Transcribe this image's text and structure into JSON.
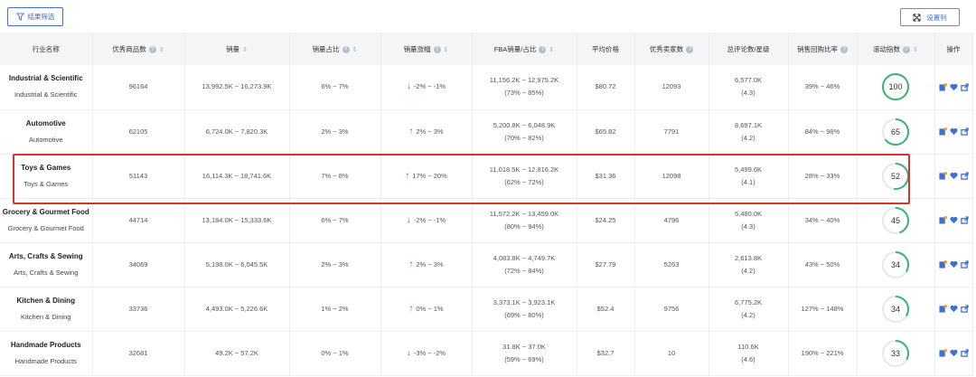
{
  "toolbar": {
    "filter_label": "结果筛选",
    "settings_label": "设置列"
  },
  "columns": [
    {
      "label": "行业名称",
      "help": false,
      "sort": false
    },
    {
      "label": "优秀商品数",
      "help": true,
      "sort": true
    },
    {
      "label": "销量",
      "help": false,
      "sort": true
    },
    {
      "label": "销量占比",
      "help": true,
      "sort": true
    },
    {
      "label": "销量涨幅",
      "help": true,
      "sort": true
    },
    {
      "label": "FBA销量/占比",
      "help": true,
      "sort": true
    },
    {
      "label": "平均价格",
      "help": false,
      "sort": false
    },
    {
      "label": "优秀卖家数",
      "help": true,
      "sort": false
    },
    {
      "label": "总评论数/星级",
      "help": false,
      "sort": false
    },
    {
      "label": "销售回购比率",
      "help": true,
      "sort": false
    },
    {
      "label": "滚动指数",
      "help": true,
      "sort": true
    },
    {
      "label": "操作",
      "help": false,
      "sort": false
    }
  ],
  "colors": {
    "accent": "#3d6fd6",
    "ring_green": "#3cb371",
    "ring_track": "#e6e8eb",
    "highlight": "#d63333"
  },
  "rows": [
    {
      "name": "Industrial & Scientific",
      "sub": "Industrial & Scientific",
      "products": "96164",
      "sales": "13,992.5K ~ 16,273.9K",
      "share": "6% ~ 7%",
      "growth_dir": "down",
      "growth": "-2% ~ -1%",
      "fba": "11,156.2K ~ 12,975.2K",
      "fba_pct": "(73% ~ 85%)",
      "price": "$80.72",
      "sellers": "12093",
      "reviews": "6,577.0K",
      "stars": "(4.3)",
      "repurchase": "39% ~ 46%",
      "score": 100
    },
    {
      "name": "Automotive",
      "sub": "Automotive",
      "products": "62105",
      "sales": "6,724.0K ~ 7,820.3K",
      "share": "2% ~ 3%",
      "growth_dir": "up",
      "growth": "2% ~ 3%",
      "fba": "5,200.8K ~ 6,048.9K",
      "fba_pct": "(70% ~ 82%)",
      "price": "$65.82",
      "sellers": "7791",
      "reviews": "8,697.1K",
      "stars": "(4.2)",
      "repurchase": "84% ~ 98%",
      "score": 65
    },
    {
      "name": "Toys & Games",
      "sub": "Toys & Games",
      "products": "51143",
      "sales": "16,114.3K ~ 18,741.6K",
      "share": "7% ~ 8%",
      "growth_dir": "up",
      "growth": "17% ~ 20%",
      "fba": "11,018.5K ~ 12,816.2K",
      "fba_pct": "(62% ~ 72%)",
      "price": "$31.36",
      "sellers": "12098",
      "reviews": "5,499.6K",
      "stars": "(4.1)",
      "repurchase": "28% ~ 33%",
      "score": 52
    },
    {
      "name": "Grocery & Gourmet Food",
      "sub": "Grocery & Gourmet Food",
      "products": "44714",
      "sales": "13,184.0K ~ 15,333.6K",
      "share": "6% ~ 7%",
      "growth_dir": "down",
      "growth": "-2% ~ -1%",
      "fba": "11,572.2K ~ 13,459.0K",
      "fba_pct": "(80% ~ 94%)",
      "price": "$24.25",
      "sellers": "4796",
      "reviews": "5,480.0K",
      "stars": "(4.3)",
      "repurchase": "34% ~ 40%",
      "score": 45
    },
    {
      "name": "Arts, Crafts & Sewing",
      "sub": "Arts, Crafts & Sewing",
      "products": "34069",
      "sales": "5,198.0K ~ 6,045.5K",
      "share": "2% ~ 3%",
      "growth_dir": "up",
      "growth": "2% ~ 3%",
      "fba": "4,083.8K ~ 4,749.7K",
      "fba_pct": "(72% ~ 84%)",
      "price": "$27.79",
      "sellers": "5263",
      "reviews": "2,613.8K",
      "stars": "(4.2)",
      "repurchase": "43% ~ 50%",
      "score": 34
    },
    {
      "name": "Kitchen & Dining",
      "sub": "Kitchen & Dining",
      "products": "33736",
      "sales": "4,493.0K ~ 5,226.6K",
      "share": "1% ~ 2%",
      "growth_dir": "up",
      "growth": "0% ~ 1%",
      "fba": "3,373.1K ~ 3,923.1K",
      "fba_pct": "(69% ~ 80%)",
      "price": "$52.4",
      "sellers": "9756",
      "reviews": "6,775.2K",
      "stars": "(4.2)",
      "repurchase": "127% ~ 148%",
      "score": 34
    },
    {
      "name": "Handmade Products",
      "sub": "Handmade Products",
      "products": "32681",
      "sales": "49.2K ~ 57.2K",
      "share": "0% ~ 1%",
      "growth_dir": "down",
      "growth": "-3% ~ -2%",
      "fba": "31.8K ~ 37.0K",
      "fba_pct": "(59% ~ 69%)",
      "price": "$32.7",
      "sellers": "10",
      "reviews": "110.6K",
      "stars": "(4.6)",
      "repurchase": "190% ~ 221%",
      "score": 33
    }
  ],
  "icons": {
    "filter": "filter-icon",
    "settings": "expand-arrows-icon",
    "help": "question-icon",
    "sort": "sort-icon",
    "ops": [
      "edit-icon",
      "heart-icon",
      "share-icon"
    ]
  }
}
